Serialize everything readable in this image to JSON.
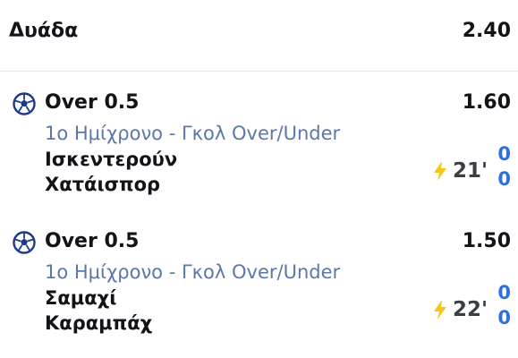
{
  "header": {
    "title": "Δυάδα",
    "odds": "2.40"
  },
  "bets": [
    {
      "market": "Over 0.5",
      "odds": "1.60",
      "category": "1ο Ημίχρονο - Γκολ Over/Under",
      "home_team": "Ισκεντερούν",
      "away_team": "Χατάισπορ",
      "minute": "21'",
      "home_score": "0",
      "away_score": "0"
    },
    {
      "market": "Over 0.5",
      "odds": "1.50",
      "category": "1ο Ημίχρονο - Γκολ Over/Under",
      "home_team": "Σαμαχί",
      "away_team": "Καραμπάχ",
      "minute": "22'",
      "home_score": "0",
      "away_score": "0"
    }
  ],
  "icons": {
    "sport": "soccer-ball-icon",
    "live": "lightning-icon"
  },
  "colors": {
    "category": "#5b78a8",
    "score": "#2f6fe0",
    "live": "#f5c518",
    "ball": "#1e3a8a"
  }
}
